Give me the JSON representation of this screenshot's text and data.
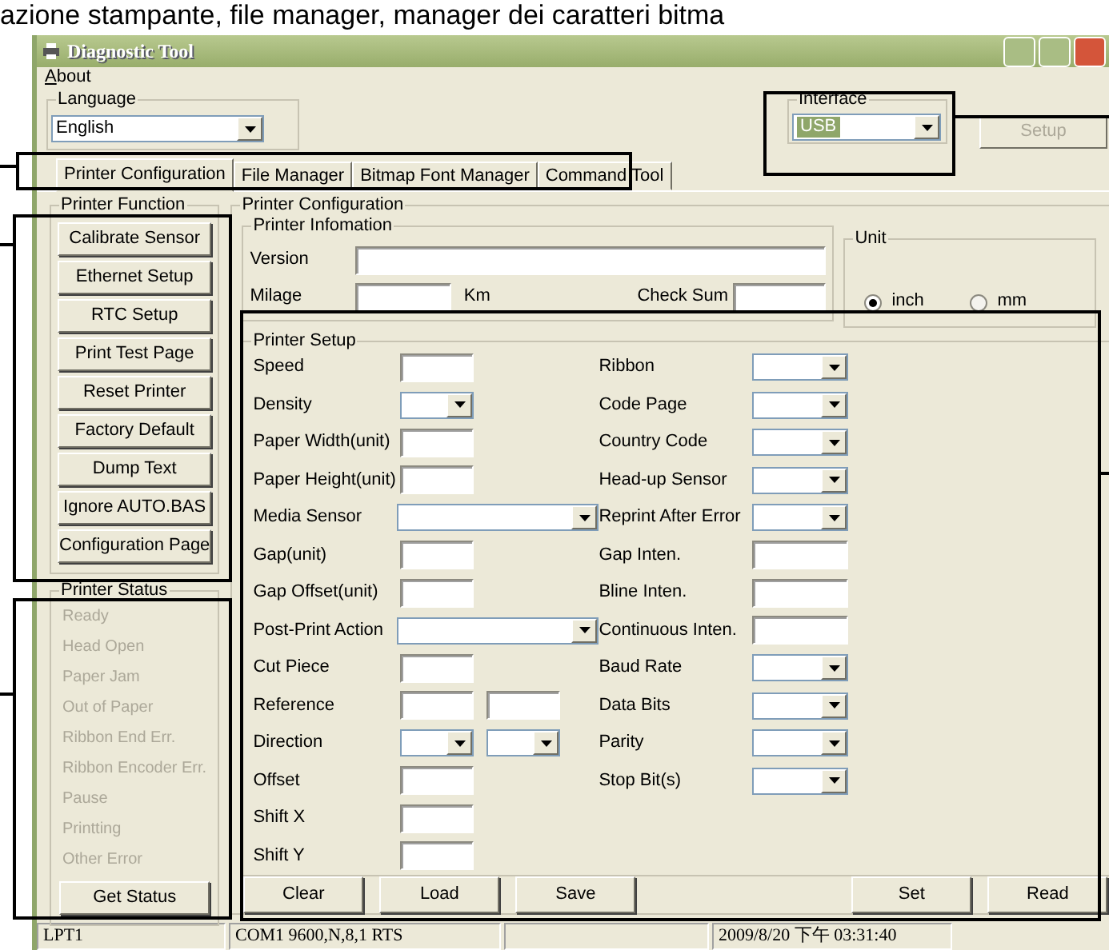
{
  "caption": "azione stampante, file manager, manager dei caratteri bitma",
  "window": {
    "title": "Diagnostic Tool"
  },
  "menu": [
    "About"
  ],
  "language": {
    "label": "Language",
    "value": "English"
  },
  "interface": {
    "label": "Interface",
    "value": "USB",
    "selected": true
  },
  "setup_button": {
    "label": "Setup",
    "disabled": true
  },
  "tabs": [
    {
      "label": "Printer Configuration",
      "selected": true
    },
    {
      "label": "File Manager",
      "selected": false
    },
    {
      "label": "Bitmap Font Manager",
      "selected": false
    },
    {
      "label": "Command Tool",
      "selected": false
    }
  ],
  "printer_function": {
    "title": "Printer Function",
    "buttons": [
      "Calibrate Sensor",
      "Ethernet Setup",
      "RTC Setup",
      "Print Test Page",
      "Reset Printer",
      "Factory Default",
      "Dump Text",
      "Ignore AUTO.BAS",
      "Configuration Page"
    ]
  },
  "printer_status": {
    "title": "Printer Status",
    "items": [
      {
        "label": "Ready",
        "disabled": true
      },
      {
        "label": "Head Open",
        "disabled": true
      },
      {
        "label": "Paper Jam",
        "disabled": true
      },
      {
        "label": "Out of Paper",
        "disabled": true
      },
      {
        "label": "Ribbon End Err.",
        "disabled": true
      },
      {
        "label": "Ribbon Encoder Err.",
        "disabled": true
      },
      {
        "label": "Pause",
        "disabled": true
      },
      {
        "label": "Printting",
        "disabled": true
      },
      {
        "label": "Other Error",
        "disabled": true
      }
    ],
    "button": "Get Status"
  },
  "printer_configuration": {
    "title": "Printer Configuration",
    "info": {
      "title": "Printer Infomation",
      "version_label": "Version",
      "milage_label": "Milage",
      "milage_unit": "Km",
      "checksum_label": "Check Sum"
    },
    "unit": {
      "title": "Unit",
      "options": [
        {
          "label": "inch",
          "selected": true
        },
        {
          "label": "mm",
          "selected": false
        }
      ]
    },
    "setup": {
      "title": "Printer Setup",
      "left": [
        {
          "label": "Speed",
          "kind": "text"
        },
        {
          "label": "Density",
          "kind": "select"
        },
        {
          "label": "Paper Width(unit)",
          "kind": "text"
        },
        {
          "label": "Paper Height(unit)",
          "kind": "text"
        },
        {
          "label": "Media Sensor",
          "kind": "wide"
        },
        {
          "label": "Gap(unit)",
          "kind": "text"
        },
        {
          "label": "Gap Offset(unit)",
          "kind": "text"
        },
        {
          "label": "Post-Print Action",
          "kind": "wide"
        },
        {
          "label": "Cut Piece",
          "kind": "text"
        },
        {
          "label": "Reference",
          "kind": "text2"
        },
        {
          "label": "Direction",
          "kind": "select2"
        },
        {
          "label": "Offset",
          "kind": "text"
        },
        {
          "label": "Shift X",
          "kind": "text"
        },
        {
          "label": "Shift Y",
          "kind": "text"
        }
      ],
      "right": [
        {
          "label": "Ribbon",
          "kind": "select"
        },
        {
          "label": "Code Page",
          "kind": "select"
        },
        {
          "label": "Country Code",
          "kind": "select"
        },
        {
          "label": "Head-up Sensor",
          "kind": "select"
        },
        {
          "label": "Reprint After Error",
          "kind": "select"
        },
        {
          "label": "Gap Inten.",
          "kind": "text"
        },
        {
          "label": "Bline Inten.",
          "kind": "text"
        },
        {
          "label": "Continuous Inten.",
          "kind": "text"
        },
        {
          "label": "Baud Rate",
          "kind": "select"
        },
        {
          "label": "Data Bits",
          "kind": "select"
        },
        {
          "label": "Parity",
          "kind": "select"
        },
        {
          "label": "Stop Bit(s)",
          "kind": "select"
        }
      ],
      "buttons": [
        "Clear",
        "Load",
        "Save",
        "Set",
        "Read"
      ]
    }
  },
  "status_bar": [
    "LPT1",
    "COM1 9600,N,8,1 RTS",
    "2009/8/20 下午 03:31:40"
  ]
}
